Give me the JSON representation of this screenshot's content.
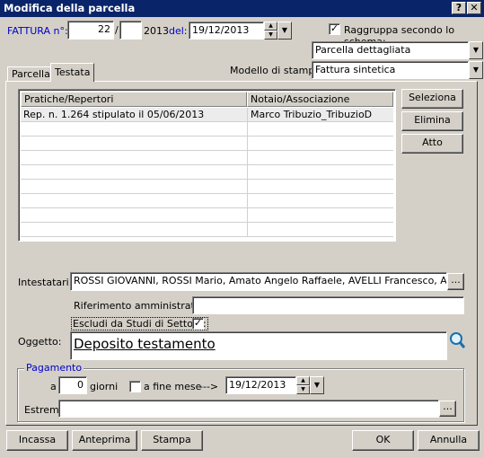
{
  "window": {
    "title": "Modifica della parcella",
    "help_btn": "?",
    "close_btn": "✕"
  },
  "invoice": {
    "label": "FATTURA n°:",
    "number": "22",
    "separator": "/",
    "suffix": "",
    "year": "2013",
    "date_label": "del:",
    "date": "19/12/2013"
  },
  "grouping": {
    "label": "Raggruppa secondo lo schema:",
    "checked": "✓"
  },
  "schema_select": {
    "value": "Parcella dettagliata"
  },
  "print_model": {
    "label": "Modello di stampa:",
    "value": "Fattura sintetica"
  },
  "tabs": [
    {
      "label": "Parcella"
    },
    {
      "label": "Testata"
    }
  ],
  "grid": {
    "columns": [
      "Pratiche/Repertori",
      "Notaio/Associazione"
    ],
    "rows": [
      [
        "Rep. n. 1.264 stipulato il 05/06/2013",
        "Marco Tribuzio_TribuzioD"
      ]
    ]
  },
  "side_buttons": {
    "select": "Seleziona",
    "delete": "Elimina",
    "act": "Atto"
  },
  "holders": {
    "label": "Intestatari:",
    "value": "ROSSI GIOVANNI, ROSSI Mario, Amato Angelo Raffaele, AVELLI Francesco, ANTONAC",
    "browse": "..."
  },
  "admin_ref": {
    "label": "Riferimento amministrativo:",
    "value": ""
  },
  "exclude": {
    "label": "Escludi da Studi di Settore:",
    "checked": "✓"
  },
  "subject": {
    "label": "Oggetto:",
    "value": "Deposito testamento"
  },
  "payment": {
    "legend": "Pagamento",
    "a_label": "a",
    "days": "0",
    "days_label": "giorni",
    "end_month_label": "a fine mese",
    "arrow": "--->",
    "date": "19/12/2013",
    "extremes_label": "Estremi",
    "extremes_value": "",
    "browse": "..."
  },
  "footer": {
    "collect": "Incassa",
    "preview": "Anteprima",
    "print": "Stampa",
    "ok": "OK",
    "cancel": "Annulla"
  }
}
